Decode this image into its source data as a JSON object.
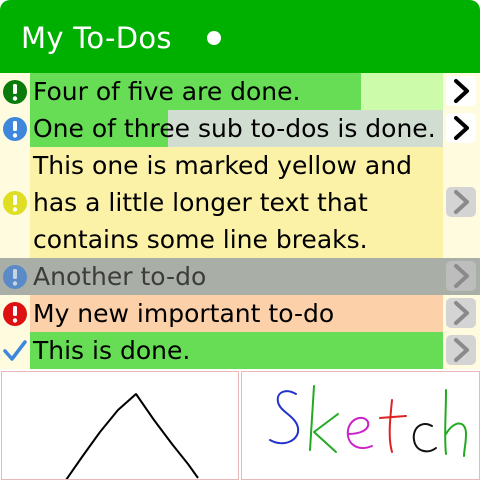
{
  "header": {
    "title": "My To-Dos"
  },
  "todos": [
    {
      "text": "Four of five are done.",
      "status": "important-green",
      "icons": [
        "exclamation-icon",
        "chevron-right-icon"
      ],
      "progress": 0.8,
      "colors": {
        "row": "#ccfcaa",
        "progress": "#66dd55",
        "status": "#0a7a0a"
      }
    },
    {
      "text": "One of three sub to-dos is done.",
      "status": "important-blue",
      "icons": [
        "exclamation-icon",
        "chevron-right-icon"
      ],
      "progress": 0.333,
      "colors": {
        "row": "#d2ddd2",
        "progress": "#66dd55",
        "status": "#3d88dd"
      }
    },
    {
      "text_lines": [
        "This one is marked yellow and",
        "has a little longer text that",
        "contains some line breaks."
      ],
      "status": "important-yellow",
      "icons": [
        "exclamation-icon",
        "chevron-right-icon"
      ],
      "colors": {
        "row": "#fbf1a7",
        "status": "#dede22"
      }
    },
    {
      "text": "Another to-do",
      "status": "important-blue-muted",
      "icons": [
        "exclamation-icon",
        "chevron-right-icon"
      ],
      "colors": {
        "row": "#a9afa7",
        "status": "#5a8ac8"
      }
    },
    {
      "text": "My new important to-do",
      "status": "important-red",
      "icons": [
        "exclamation-icon",
        "chevron-right-icon"
      ],
      "colors": {
        "row": "#fcd0a8",
        "status": "#dd1111"
      }
    },
    {
      "text": "This is done.",
      "status": "done",
      "icons": [
        "checkmark-icon",
        "chevron-right-icon"
      ],
      "colors": {
        "row": "#66dd55",
        "status": "#3d88dd"
      }
    }
  ],
  "sketches": [
    {
      "name": "triangle-drawing"
    },
    {
      "name": "colored-handwriting-drawing",
      "text": "Sketch"
    }
  ],
  "colors": {
    "header": "#00b000",
    "list_background": "#fffbdf"
  }
}
